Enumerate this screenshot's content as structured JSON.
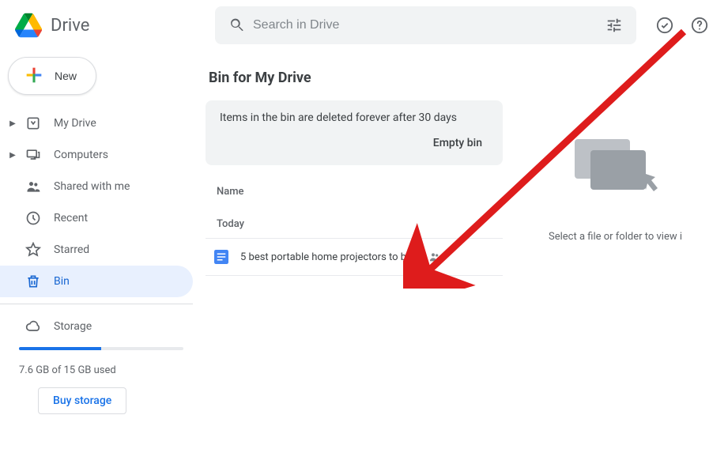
{
  "header": {
    "app_name": "Drive",
    "search_placeholder": "Search in Drive"
  },
  "sidebar": {
    "new_label": "New",
    "items": [
      {
        "label": "My Drive",
        "has_children": true
      },
      {
        "label": "Computers",
        "has_children": true
      },
      {
        "label": "Shared with me",
        "has_children": false
      },
      {
        "label": "Recent",
        "has_children": false
      },
      {
        "label": "Starred",
        "has_children": false
      },
      {
        "label": "Bin",
        "has_children": false
      }
    ],
    "storage_label": "Storage",
    "storage_used_text": "7.6 GB of 15 GB used",
    "storage_fill_percent": 50,
    "buy_storage_label": "Buy storage"
  },
  "main": {
    "title": "Bin for My Drive",
    "banner_text": "Items in the bin are deleted forever after 30 days",
    "banner_action": "Empty bin",
    "column_header": "Name",
    "group_label": "Today",
    "files": [
      {
        "name": "5 best portable home projectors to buy",
        "shared": true,
        "type": "doc"
      }
    ],
    "detail_prompt": "Select a file or folder to view i"
  }
}
